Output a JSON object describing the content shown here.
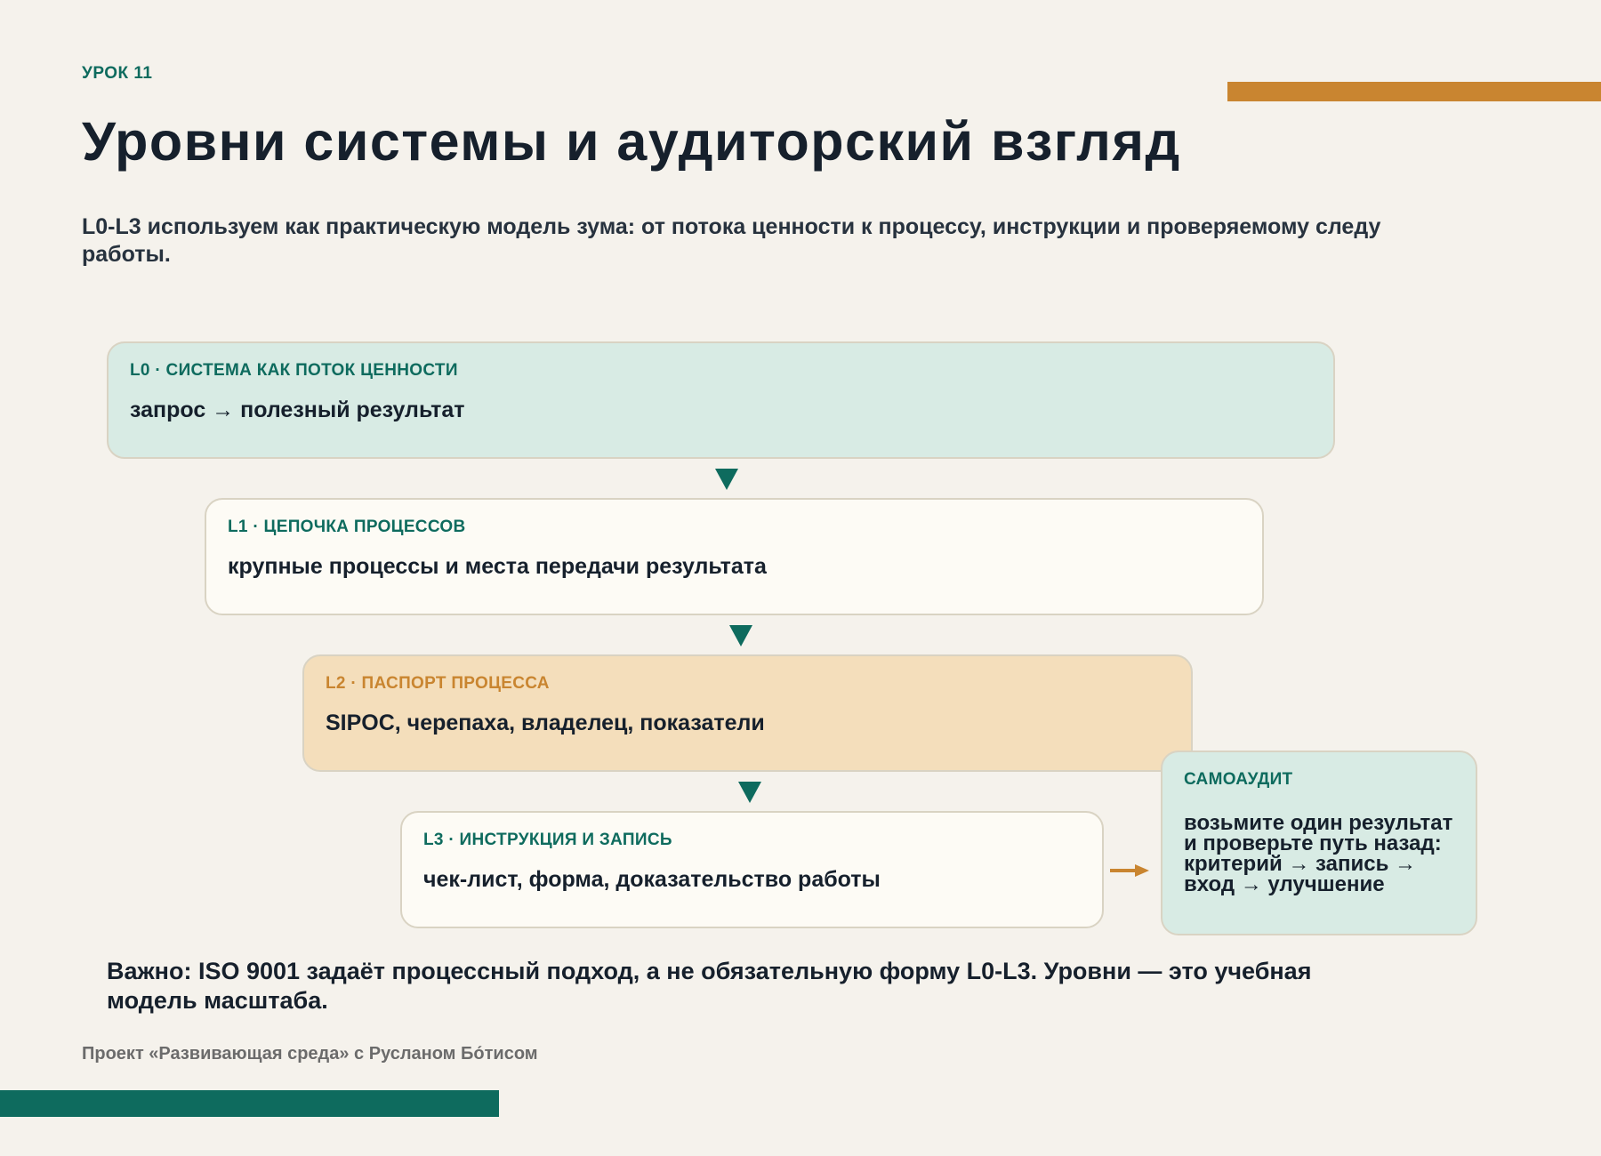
{
  "header": {
    "lesson_label": "УРОК 11",
    "title": "Уровни системы и аудиторский взгляд",
    "subtitle": "L0-L3 используем как практическую модель зума: от потока ценности к процессу, инструкции и проверяемому следу работы."
  },
  "colors": {
    "background": "#f5f2ec",
    "teal": "#0e6b5e",
    "orange": "#c98530",
    "light_teal": "#d8ebe4",
    "light_orange": "#f4debb",
    "cream": "#fdfbf5",
    "text": "#16202c"
  },
  "levels": [
    {
      "label": "L0 · СИСТЕМА КАК ПОТОК ЦЕННОСТИ",
      "text": "запрос → полезный результат"
    },
    {
      "label": "L1 · ЦЕПОЧКА ПРОЦЕССОВ",
      "text": "крупные процессы и места передачи результата"
    },
    {
      "label": "L2 · ПАСПОРТ ПРОЦЕССА",
      "text": "SIPOC, черепаха, владелец, показатели"
    },
    {
      "label": "L3 · ИНСТРУКЦИЯ И ЗАПИСЬ",
      "text": "чек-лист, форма, доказательство работы"
    }
  ],
  "audit": {
    "label": "САМОАУДИТ",
    "text": "возьмите один результат и проверьте путь назад: критерий → запись → вход → улучшение"
  },
  "note": "Важно: ISO 9001 задаёт процессный подход, а не обязательную форму L0-L3. Уровни — это учебная модель масштаба.",
  "footer": "Проект «Развивающая среда» с Русланом Бо́тисом"
}
